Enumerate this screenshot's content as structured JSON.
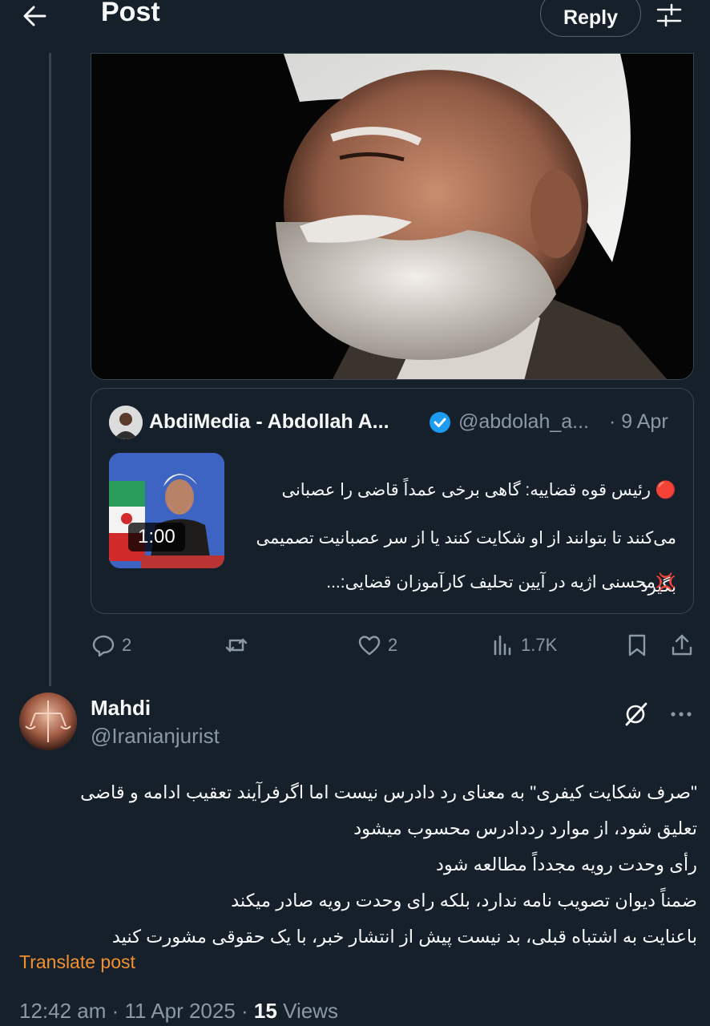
{
  "header": {
    "title": "Post",
    "reply_label": "Reply"
  },
  "quote": {
    "name": "AbdiMedia - Abdollah A...",
    "handle": "@abdolah_a...",
    "date": "· 9 Apr",
    "video_duration": "1:00",
    "text_line1": "🔴 رئیس قوه قضاییه: گاهی برخی عمداً قاضی را عصبانی",
    "text_line2": "می‌کنند تا بتوانند از او شکایت کنند یا از سر عصبانیت تصمیمی",
    "text_line3": "بگیرد",
    "text_line4": "💢محسنی اژیه در آیین تحلیف کارآموزان قضایی:..."
  },
  "actions": {
    "replies": "2",
    "likes": "2",
    "views": "1.7K"
  },
  "reply": {
    "name": "Mahdi",
    "handle": "@Iranianjurist",
    "lines": [
      "\"صرف شکایت کیفری\" به معنای رد دادرس نیست اما اگرفرآیند تعقیب ادامه و قاضی",
      "تعلیق شود، از موارد رددادرس محسوب میشود",
      "رأی وحدت رویه مجدداً مطالعه شود",
      "ضمناً دیوان تصویب نامه ندارد، بلکه رای وحدت رویه صادر میکند",
      "باعنایت به اشتباه قبلی، بد نیست پیش از انتشار خبر، با یک حقوقی مشورت کنید"
    ],
    "translate_label": "Translate post",
    "time": "12:42 am · 11 Apr 2025 · ",
    "views_count": "15",
    "views_label": " Views"
  },
  "colors": {
    "background": "#15202b",
    "accent_blue": "#1d9bf0",
    "translate_orange": "#f4912f",
    "muted": "#8b98a5"
  },
  "icons": [
    "back-arrow-icon",
    "filter-icon",
    "verified-badge-icon",
    "reply-icon",
    "retweet-icon",
    "like-icon",
    "views-icon",
    "bookmark-icon",
    "share-icon",
    "grok-icon",
    "more-icon"
  ]
}
